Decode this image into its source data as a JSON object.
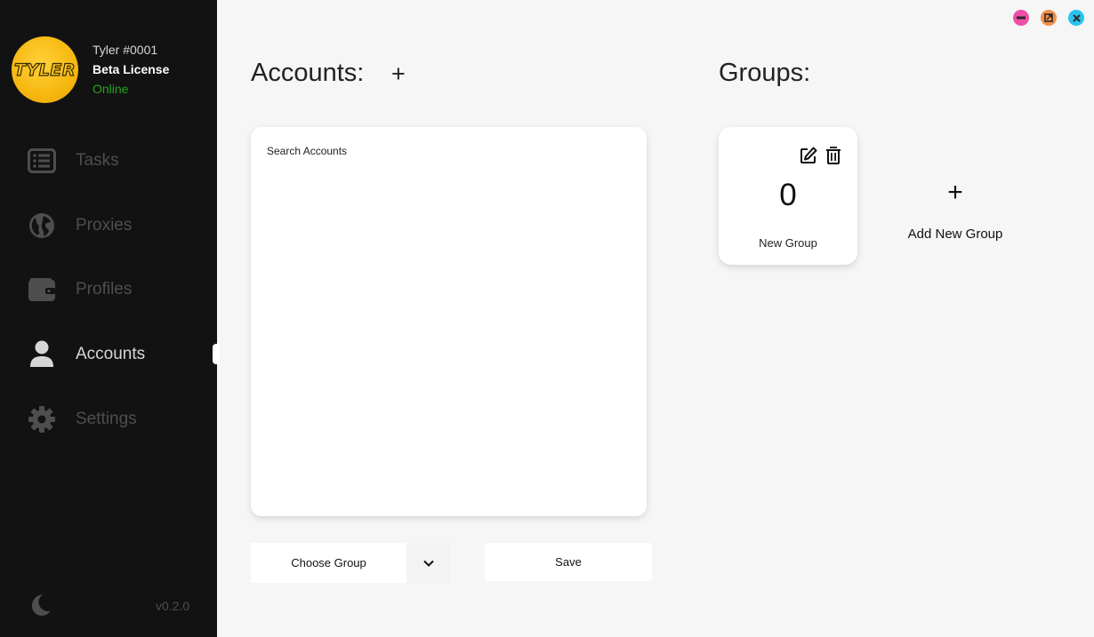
{
  "user": {
    "avatar_text": "TYLER",
    "name": "Tyler #0001",
    "license": "Beta License",
    "status": "Online"
  },
  "nav": {
    "items": [
      {
        "label": "Tasks",
        "icon": "list-icon"
      },
      {
        "label": "Proxies",
        "icon": "globe-icon"
      },
      {
        "label": "Profiles",
        "icon": "wallet-icon"
      },
      {
        "label": "Accounts",
        "icon": "user-icon",
        "active": true
      },
      {
        "label": "Settings",
        "icon": "gear-icon"
      }
    ]
  },
  "footer": {
    "version": "v0.2.0",
    "theme_icon": "moon-icon"
  },
  "window_controls": {
    "minimize_color": "#ee4fa6",
    "maximize_color": "#f2904a",
    "close_color": "#29c3f0"
  },
  "accounts": {
    "title": "Accounts:",
    "add_label": "+",
    "search_placeholder": "Search Accounts",
    "choose_group_label": "Choose Group",
    "save_label": "Save"
  },
  "groups": {
    "title": "Groups:",
    "cards": [
      {
        "count": "0",
        "name": "New Group"
      }
    ],
    "add_plus": "+",
    "add_label": "Add New Group"
  },
  "colors": {
    "sidebar_bg": "#121212",
    "main_bg": "#f6f6f6",
    "status_online": "#27a31c",
    "avatar_yellow": "#f6b70f"
  }
}
